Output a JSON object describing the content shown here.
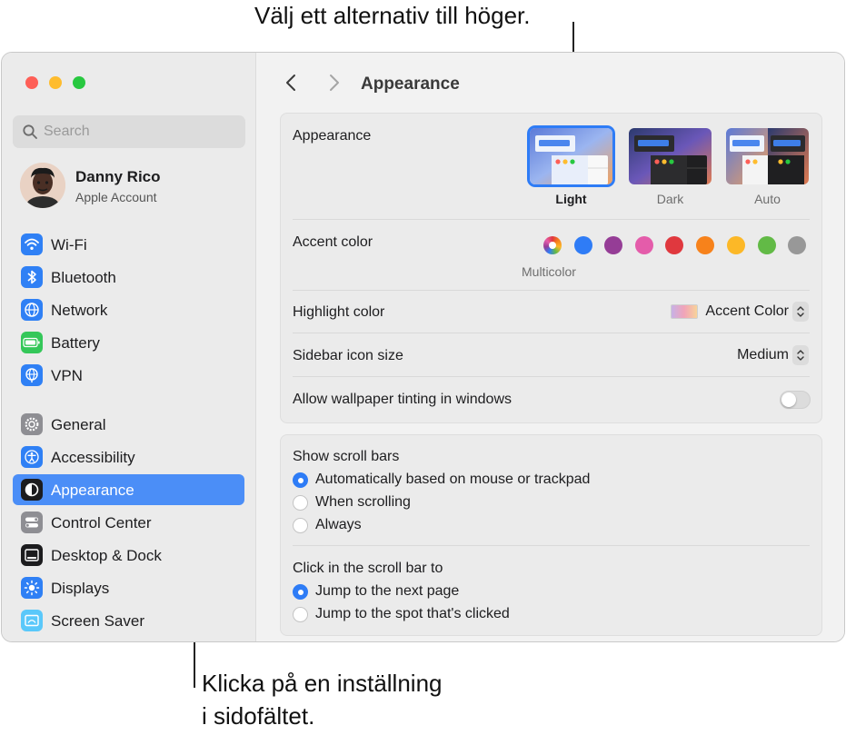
{
  "callouts": {
    "top": "Välj ett alternativ till höger.",
    "bottom_line1": "Klicka på en inställning",
    "bottom_line2": "i sidofältet."
  },
  "sidebar": {
    "search_placeholder": "Search",
    "account": {
      "name": "Danny Rico",
      "subtitle": "Apple Account"
    },
    "items": [
      {
        "label": "Wi-Fi",
        "icon": "wifi-icon",
        "color": "#2f80f5"
      },
      {
        "label": "Bluetooth",
        "icon": "bluetooth-icon",
        "color": "#2f80f5"
      },
      {
        "label": "Network",
        "icon": "network-globe-icon",
        "color": "#2f80f5"
      },
      {
        "label": "Battery",
        "icon": "battery-icon",
        "color": "#34c759"
      },
      {
        "label": "VPN",
        "icon": "vpn-globe-icon",
        "color": "#2f80f5"
      },
      {
        "label": "General",
        "icon": "gear-icon",
        "color": "#8e8e93"
      },
      {
        "label": "Accessibility",
        "icon": "accessibility-icon",
        "color": "#2f80f5"
      },
      {
        "label": "Appearance",
        "icon": "appearance-icon",
        "color": "#1c1c1e",
        "selected": true
      },
      {
        "label": "Control Center",
        "icon": "control-center-icon",
        "color": "#8e8e93"
      },
      {
        "label": "Desktop & Dock",
        "icon": "desktop-dock-icon",
        "color": "#1c1c1e"
      },
      {
        "label": "Displays",
        "icon": "displays-sun-icon",
        "color": "#2f80f5"
      },
      {
        "label": "Screen Saver",
        "icon": "screen-saver-icon",
        "color": "#5ac8fa"
      }
    ]
  },
  "content": {
    "title": "Appearance",
    "appearance": {
      "label": "Appearance",
      "options": [
        "Light",
        "Dark",
        "Auto"
      ],
      "selected": "Light"
    },
    "accent": {
      "label": "Accent color",
      "multicolor_label": "Multicolor",
      "colors": [
        "#2f7cf6",
        "#953d96",
        "#e45caa",
        "#e0383e",
        "#f7821b",
        "#fcb827",
        "#62ba46",
        "#989898"
      ]
    },
    "highlight": {
      "label": "Highlight color",
      "value": "Accent Color"
    },
    "sidebar_icon_size": {
      "label": "Sidebar icon size",
      "value": "Medium"
    },
    "wallpaper_tinting": {
      "label": "Allow wallpaper tinting in windows",
      "enabled": false
    },
    "scroll_bars": {
      "label": "Show scroll bars",
      "options": [
        "Automatically based on mouse or trackpad",
        "When scrolling",
        "Always"
      ],
      "selected_index": 0
    },
    "click_scroll": {
      "label": "Click in the scroll bar to",
      "options": [
        "Jump to the next page",
        "Jump to the spot that's clicked"
      ],
      "selected_index": 0
    }
  }
}
